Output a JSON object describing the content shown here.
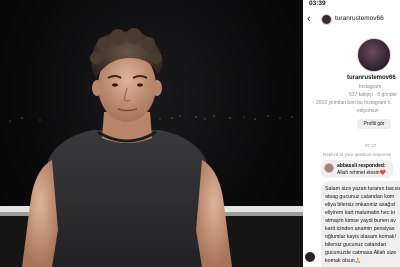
{
  "status_bar": {
    "time": "03:39"
  },
  "header": {
    "username": "turanrustemov66",
    "back_icon": "chevron-left-icon"
  },
  "profile": {
    "name": "turanrustemov66",
    "platform": "Instagram",
    "stats": "537 takipçi · 8 gönder",
    "since": "2022 yılından beri bu Instagram h",
    "since_2": "ediyorsun",
    "view_profile_label": "Profili gör"
  },
  "conversation": {
    "time_label": "07:27",
    "reply_note": "Replied to your question response",
    "story": {
      "user": "abbassli responded:",
      "text": "Allah rehmet elesin❤️"
    },
    "message_lines": [
      "Salam sizə yazan turanın bacısı",
      "atsag gucunuz catandan kom",
      "eliya bilersiz imkaniniz asağıd",
      "eliyirem kart malumatin hec ki",
      "atmayin kimse yaydi bunen av",
      "karti icinden anamin pensiyas",
      "oğlumlar kayis olasam komak!",
      "bilersiz gucunuz catandan",
      "gucunuzde catmasa Allah size",
      "komak olsun🙏"
    ]
  }
}
